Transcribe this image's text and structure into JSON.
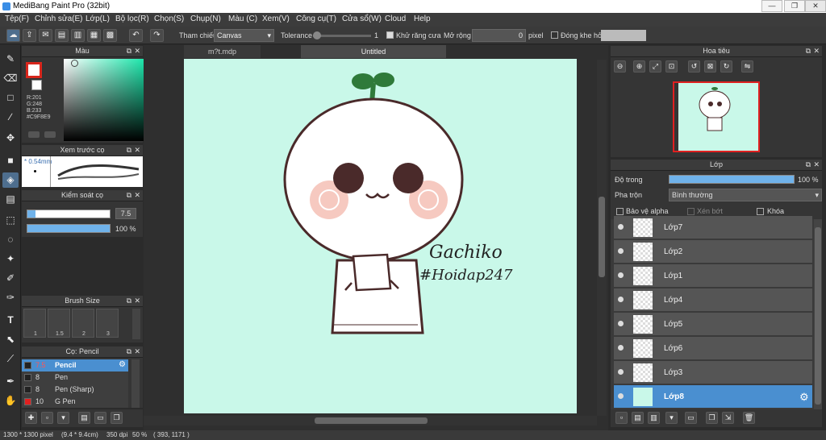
{
  "window": {
    "title": "MediBang Paint Pro (32bit)",
    "min": "—",
    "max": "❐",
    "close": "✕"
  },
  "menu": [
    "Tệp(F)",
    "Chỉnh sửa(E)",
    "Lớp(L)",
    "Bộ lọc(R)",
    "Chọn(S)",
    "Chụp(N)",
    "Màu (C)",
    "Xem(V)",
    "Công cụ(T)",
    "Cửa sổ(W)",
    "Cloud",
    "Help"
  ],
  "toolbar": {
    "reference_label": "Tham chiếu",
    "reference_value": "Canvas",
    "tolerance_label": "Tolerance",
    "tolerance_value": "1",
    "antialias_label": "Khử răng cưa",
    "expand_label": "Mở rộng",
    "expand_value": "0",
    "expand_unit": "pixel",
    "close_gap_label": "Đóng khe hở"
  },
  "color_panel": {
    "title": "Màu",
    "r": "R:201",
    "g": "G:248",
    "b": "B:233",
    "hex": "#C9F8E9",
    "main_color": "#c9f8e9",
    "fg_color": "#d8261c"
  },
  "brush_preview": {
    "title": "Xem trước cọ",
    "size_text": "* 0.54mm"
  },
  "brush_control": {
    "title": "Kiểm soát cọ",
    "size_value": "7.5",
    "opacity_value": "100 %",
    "size_fraction": 0.1,
    "opacity_fraction": 1.0
  },
  "brush_size": {
    "title": "Brush Size",
    "sizes": [
      "1",
      "1.5",
      "2",
      "3"
    ]
  },
  "brush_list": {
    "title": "Cọ: Pencil",
    "items": [
      {
        "size": "7.5",
        "name": "Pencil",
        "color": "#4a8fd0"
      },
      {
        "size": "8",
        "name": "Pen",
        "color": "#222222"
      },
      {
        "size": "8",
        "name": "Pen (Sharp)",
        "color": "#222222"
      },
      {
        "size": "10",
        "name": "G Pen",
        "color": "#e02020"
      }
    ]
  },
  "canvas": {
    "tabs": [
      "m?t.mdp",
      "Untitled"
    ],
    "background": "#c9f8e9",
    "signature_line1": "Gachiko",
    "signature_line2": "#Hoidap247"
  },
  "navigator": {
    "title": "Hoa tiêu"
  },
  "layer_panel": {
    "title": "Lớp",
    "opacity_label": "Độ trong",
    "opacity_value": "100 %",
    "opacity_fraction": 1.0,
    "blend_label": "Pha trộn",
    "blend_value": "Bình thường",
    "protect_alpha": "Bảo vệ alpha",
    "clipping": "Xén bớt",
    "lock": "Khóa",
    "layers": [
      "Lớp7",
      "Lớp2",
      "Lớp1",
      "Lớp4",
      "Lớp5",
      "Lớp6",
      "Lớp3",
      "Lớp8"
    ],
    "active_layer": "Lớp8"
  },
  "status": {
    "canvas_size": "1300 * 1300 pixel",
    "physical_size": "(9.4 * 9.4cm)",
    "dpi": "350 dpi",
    "zoom": "50 %",
    "coords": "( 393, 1171 )"
  }
}
